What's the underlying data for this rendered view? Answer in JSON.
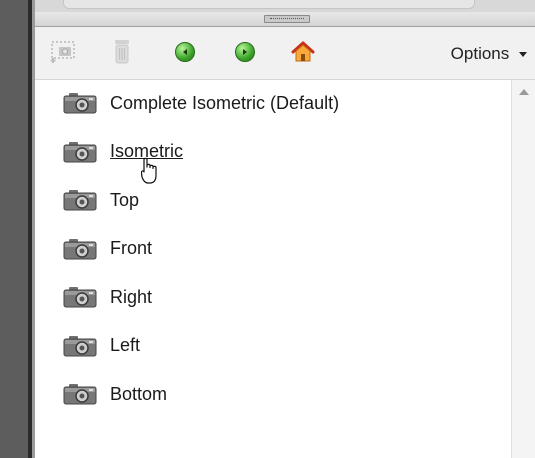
{
  "toolbar": {
    "icons": [
      "add-view-icon",
      "trash-icon",
      "back-arrow-icon",
      "forward-arrow-icon",
      "home-icon"
    ],
    "options_label": "Options",
    "colors": {
      "arrow_green": "#3aa52a",
      "home_orange": "#f08c1a",
      "home_red": "#c8301a"
    }
  },
  "views": {
    "items": [
      {
        "label": "Complete Isometric (Default)"
      },
      {
        "label": "Isometric"
      },
      {
        "label": "Top"
      },
      {
        "label": "Front"
      },
      {
        "label": "Right"
      },
      {
        "label": "Left"
      },
      {
        "label": "Bottom"
      }
    ],
    "hovered_index": 1,
    "item_icon": "camera-icon"
  }
}
